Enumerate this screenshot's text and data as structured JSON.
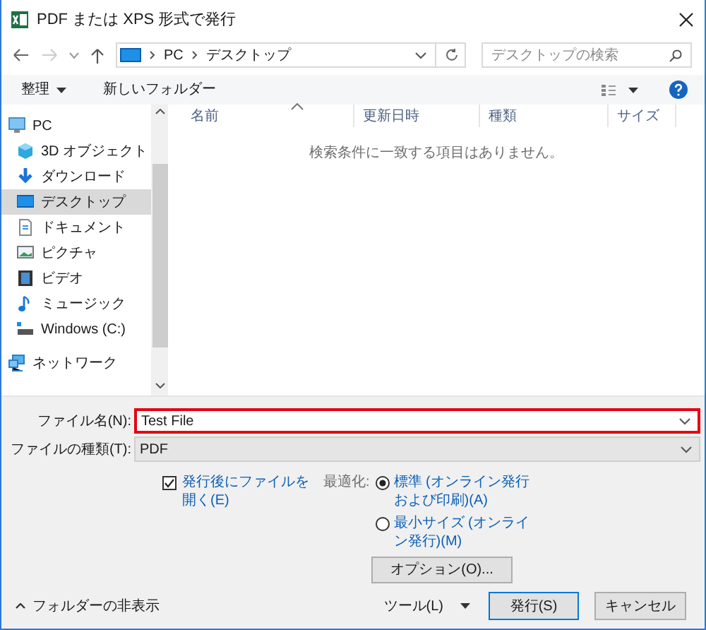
{
  "window": {
    "title": "PDF または XPS 形式で発行"
  },
  "address": {
    "path": [
      "PC",
      "デスクトップ"
    ]
  },
  "search": {
    "placeholder": "デスクトップの検索"
  },
  "toolbar": {
    "organize": "整理",
    "new_folder": "新しいフォルダー"
  },
  "sidebar": {
    "items": [
      {
        "label": "PC",
        "kind": "pc",
        "selected": false,
        "children": [
          {
            "label": "3D オブジェクト",
            "kind": "cube",
            "selected": false
          },
          {
            "label": "ダウンロード",
            "kind": "download",
            "selected": false
          },
          {
            "label": "デスクトップ",
            "kind": "desktop",
            "selected": true
          },
          {
            "label": "ドキュメント",
            "kind": "document",
            "selected": false
          },
          {
            "label": "ピクチャ",
            "kind": "pictures",
            "selected": false
          },
          {
            "label": "ビデオ",
            "kind": "video",
            "selected": false
          },
          {
            "label": "ミュージック",
            "kind": "music",
            "selected": false
          },
          {
            "label": "Windows (C:)",
            "kind": "drive",
            "selected": false
          }
        ]
      },
      {
        "label": "ネットワーク",
        "kind": "network",
        "selected": false
      }
    ]
  },
  "file_list": {
    "columns": [
      "名前",
      "更新日時",
      "種類",
      "サイズ"
    ],
    "empty_message": "検索条件に一致する項目はありません。"
  },
  "form": {
    "file_name_label": "ファイル名(N):",
    "file_name": "Test File",
    "file_type_label": "ファイルの種類(T):",
    "file_type": "PDF",
    "open_after": {
      "label": "発行後にファイルを開く(E)",
      "checked": true
    },
    "optimize_label": "最適化:",
    "optimize": [
      {
        "label": "標準 (オンライン発行および印刷)(A)",
        "selected": true
      },
      {
        "label": "最小サイズ (オンライン発行)(M)",
        "selected": false
      }
    ],
    "options_button": "オプション(O)..."
  },
  "footer": {
    "hide_folders": "フォルダーの非表示",
    "tools": "ツール(L)",
    "publish": "発行(S)",
    "cancel": "キャンセル"
  }
}
